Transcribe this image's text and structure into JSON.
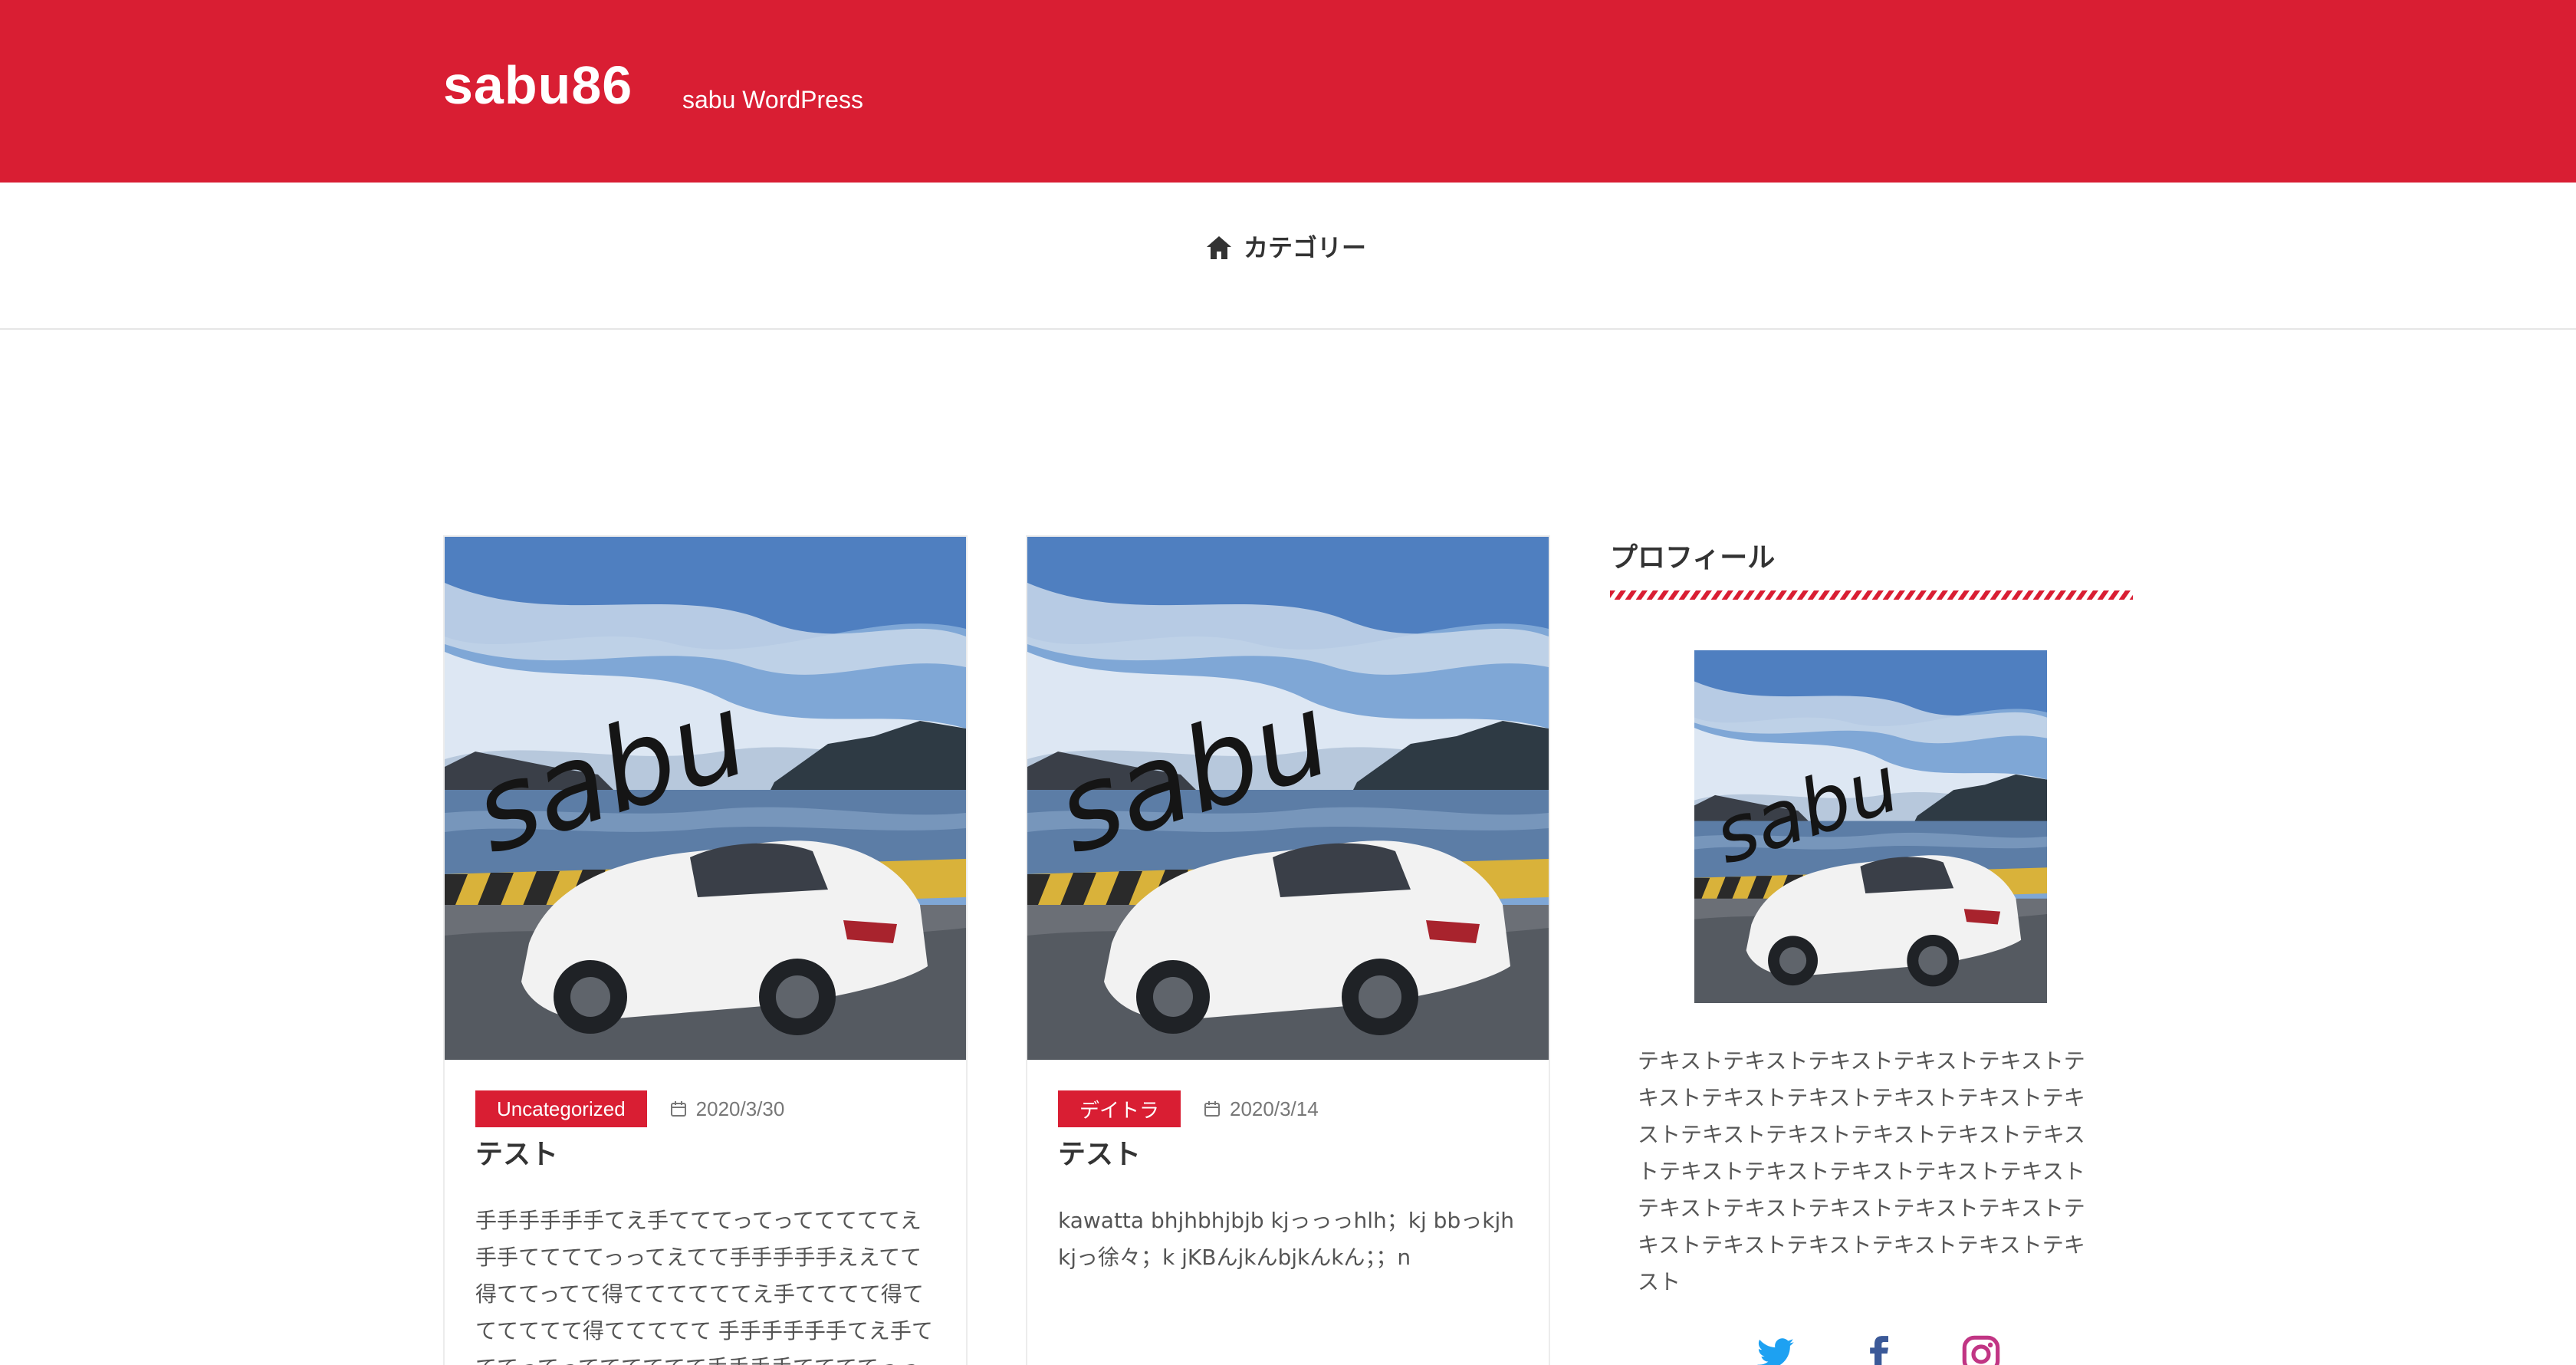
{
  "colors": {
    "accent": "#d91e33",
    "text": "#333333",
    "muted": "#777777",
    "twitter": "#1da1f2",
    "facebook": "#3b5998",
    "instagram": "#c13584"
  },
  "header": {
    "title": "sabu86",
    "description": "sabu WordPress"
  },
  "nav": {
    "items": [
      {
        "label": "カテゴリー",
        "icon": "home-icon"
      }
    ]
  },
  "posts": [
    {
      "category": "Uncategorized",
      "date": "2020/3/30",
      "title": "テスト",
      "excerpt": "手手手手手手てえ手てててってってててててえ手手ててててっってえてて手手手手手ええてて得ててってて得ててててててえ手てててて得てててててて得ててててて 手手手手手手てえ手てててってってててててて手手手手ててててっってえてて手手"
    },
    {
      "category": "デイトラ",
      "date": "2020/3/14",
      "title": "テスト",
      "excerpt": "kawatta bhjhbhjbjb kjっっっhlh；kj bbっkjhkjっ徐々；k jKBんjkんbjkんkん；；n"
    }
  ],
  "sidebar": {
    "widget_title": "プロフィール",
    "profile_text": "テキストテキストテキストテキストテキストテキストテキストテキストテキストテキストテキストテキストテキストテキストテキストテキストテキストテキストテキストテキストテキストテキストテキストテキストテキストテキストテキストテキストテキストテキストテキストテキスト",
    "social": [
      "twitter-icon",
      "facebook-icon",
      "instagram-icon"
    ]
  },
  "image": {
    "watermark": "sabu"
  }
}
